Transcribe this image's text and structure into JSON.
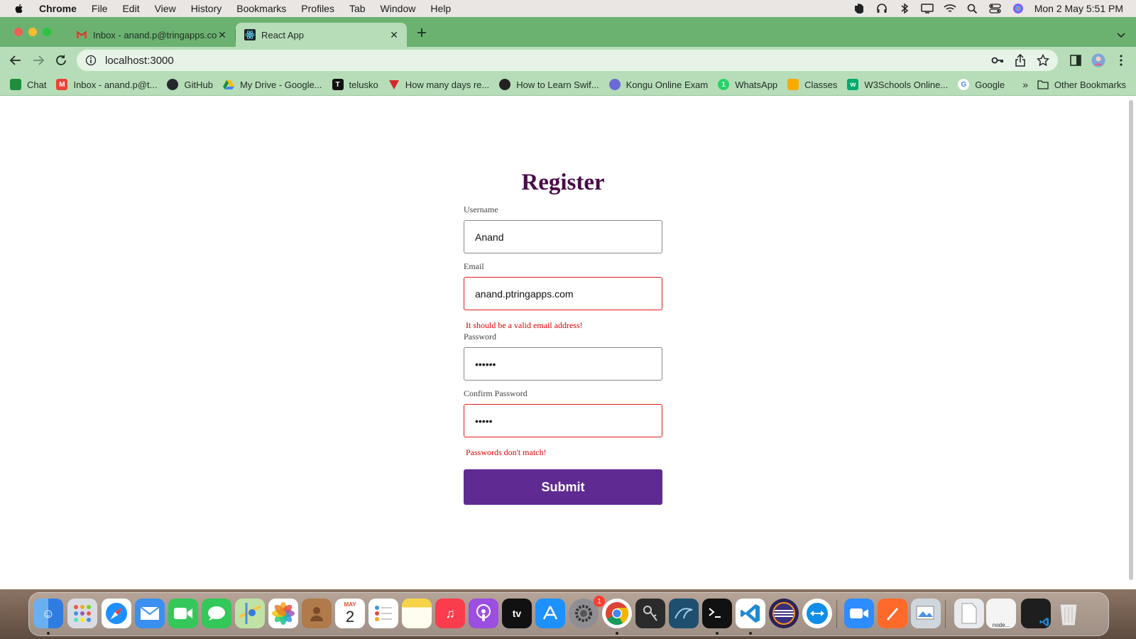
{
  "menubar": {
    "app_name": "Chrome",
    "items": [
      "File",
      "Edit",
      "View",
      "History",
      "Bookmarks",
      "Profiles",
      "Tab",
      "Window",
      "Help"
    ],
    "clock": "Mon 2 May  5:51 PM"
  },
  "tabs": [
    {
      "title": "Inbox - anand.p@tringapps.com",
      "icon": "gmail-icon",
      "active": false
    },
    {
      "title": "React App",
      "icon": "react-icon",
      "active": true
    }
  ],
  "toolbar": {
    "url": "localhost:3000"
  },
  "bookmarks": {
    "items": [
      {
        "label": "Chat",
        "icon": "google-chat-icon",
        "color": "#1e8e3e"
      },
      {
        "label": "Inbox - anand.p@t...",
        "icon": "gmail-icon",
        "color": "#ea4335"
      },
      {
        "label": "GitHub",
        "icon": "github-icon",
        "color": "#24292e"
      },
      {
        "label": "My Drive - Google...",
        "icon": "google-drive-icon",
        "color": "#fbbc04"
      },
      {
        "label": "telusko",
        "icon": "telusko-icon",
        "color": "#111111"
      },
      {
        "label": "How many days re...",
        "icon": "red-triangle-icon",
        "color": "#d62828"
      },
      {
        "label": "How to Learn Swif...",
        "icon": "swift-dark-icon",
        "color": "#222222"
      },
      {
        "label": "Kongu Online Exam",
        "icon": "kongu-icon",
        "color": "#6a6ad8"
      },
      {
        "label": "WhatsApp",
        "icon": "whatsapp-icon",
        "color": "#25d366"
      },
      {
        "label": "Classes",
        "icon": "google-classroom-icon",
        "color": "#f9ab00"
      },
      {
        "label": "W3Schools Online...",
        "icon": "w3schools-icon",
        "color": "#04aa6d"
      },
      {
        "label": "Google",
        "icon": "google-icon",
        "color": "#4285f4"
      }
    ],
    "more": "»",
    "other": "Other Bookmarks"
  },
  "form": {
    "title": "Register",
    "username_label": "Username",
    "username_value": "Anand",
    "email_label": "Email",
    "email_value": "anand.ptringapps.com",
    "email_error": "It should be a valid email address!",
    "password_label": "Password",
    "password_value": "••••••",
    "confirm_label": "Confirm Password",
    "confirm_value": "•••••",
    "confirm_error": "Passwords don't match!",
    "submit_label": "Submit",
    "title_color": "#4a0b4a",
    "button_color": "#5f2a91",
    "error_color": "#e00000"
  },
  "dock": {
    "calendar_month": "MAY",
    "calendar_day": "2",
    "settings_badge": "1",
    "tv_label": "tv",
    "node_label": "node..."
  }
}
